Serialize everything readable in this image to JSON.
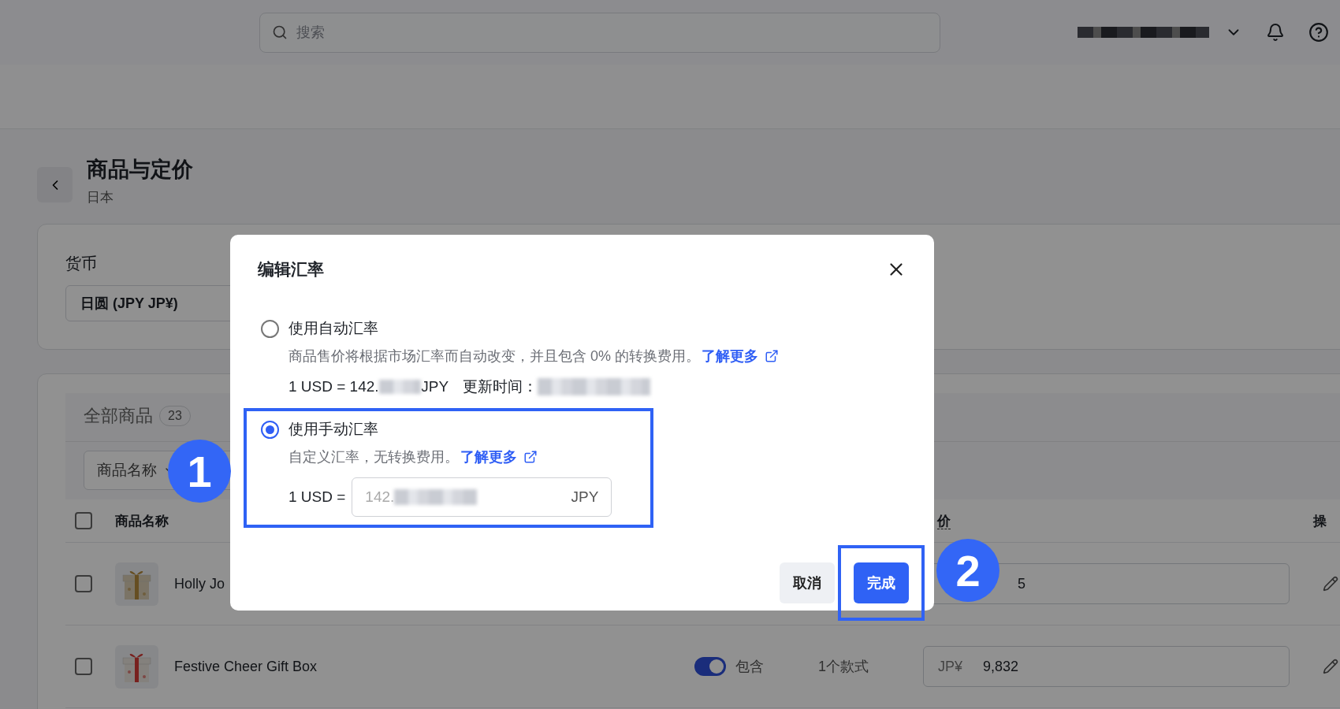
{
  "top_bar": {
    "search": {
      "placeholder": "搜索"
    }
  },
  "page": {
    "title": "商品与定价",
    "subtitle": "日本"
  },
  "currency": {
    "label": "货币",
    "value": "日圆 (JPY JP¥)"
  },
  "products": {
    "tabs": [
      {
        "label": "全部商品",
        "count": "23",
        "selected": false
      }
    ],
    "filter": {
      "value": "商品名称"
    },
    "select_all": {
      "checked": false
    },
    "columns": [
      "商品名称",
      "价",
      "操"
    ],
    "rows": [
      {
        "checked": false,
        "name": "Holly Jo",
        "price": "5"
      },
      {
        "checked": false,
        "name": "Festive Cheer Gift Box",
        "tax_included": true,
        "tax_label": "包含",
        "variants": "1个款式",
        "currency": "JP¥",
        "price": "9,832"
      }
    ]
  },
  "dialog": {
    "title": "编辑汇率",
    "options": [
      {
        "kind": "auto",
        "label": "使用自动汇率",
        "selected": false,
        "highlighted": false,
        "description": "商品售价将根据市场汇率而自动改变，并且包含 0% 的转换费用。",
        "link": "了解更多",
        "rate_prefix": "1 USD = 142.",
        "rate_unit": "JPY",
        "updated_label": "更新时间："
      },
      {
        "kind": "manual",
        "label": "使用手动汇率",
        "selected": true,
        "highlighted": true,
        "description": "自定义汇率，无转换费用。",
        "link": "了解更多",
        "rate_label": "1 USD =",
        "rate_value": "142.",
        "rate_unit": "JPY"
      }
    ],
    "buttons": [
      {
        "kind": "secondary",
        "label": "取消",
        "highlighted": false
      },
      {
        "kind": "primary",
        "label": "完成",
        "highlighted": true
      }
    ]
  },
  "callouts": [
    {
      "label": "1"
    },
    {
      "label": "2"
    }
  ]
}
